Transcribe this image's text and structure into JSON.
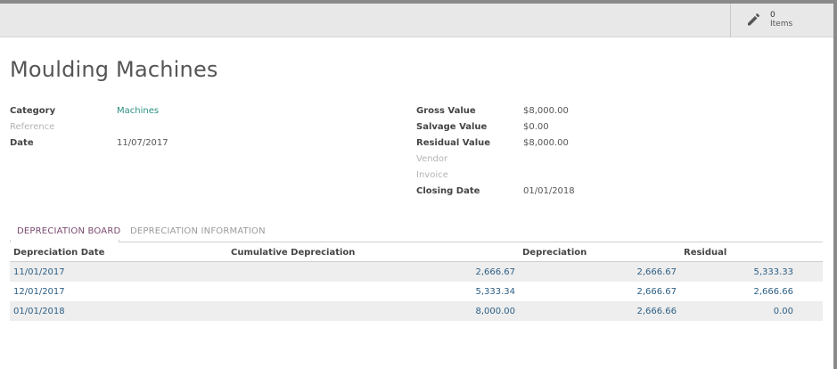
{
  "stat_button": {
    "count": "0",
    "label": "Items",
    "icon": "pencil-icon"
  },
  "record": {
    "title": "Moulding Machines",
    "fields_left": [
      {
        "label": "Category",
        "value": "Machines"
      },
      {
        "label": "Reference",
        "value": ""
      },
      {
        "label": "Date",
        "value": "11/07/2017"
      }
    ],
    "fields_right": [
      {
        "label": "Gross Value",
        "value": "$8,000.00"
      },
      {
        "label": "Salvage Value",
        "value": "$0.00"
      },
      {
        "label": "Residual Value",
        "value": "$8,000.00"
      },
      {
        "label": "Vendor",
        "value": ""
      },
      {
        "label": "Invoice",
        "value": ""
      },
      {
        "label": "Closing Date",
        "value": "01/01/2018"
      }
    ]
  },
  "tabs": [
    {
      "label": "DEPRECIATION BOARD",
      "active": true
    },
    {
      "label": "DEPRECIATION INFORMATION",
      "active": false
    }
  ],
  "table": {
    "columns": [
      "Depreciation Date",
      "Cumulative Depreciation",
      "Depreciation",
      "Residual"
    ],
    "rows": [
      [
        "11/01/2017",
        "2,666.67",
        "2,666.67",
        "5,333.33"
      ],
      [
        "12/01/2017",
        "5,333.34",
        "2,666.67",
        "2,666.66"
      ],
      [
        "01/01/2018",
        "8,000.00",
        "2,666.66",
        "0.00"
      ]
    ]
  },
  "colors": {
    "link": "#2a9083",
    "active_tab": "#7a4a6e",
    "row_text": "#2c5f86"
  }
}
